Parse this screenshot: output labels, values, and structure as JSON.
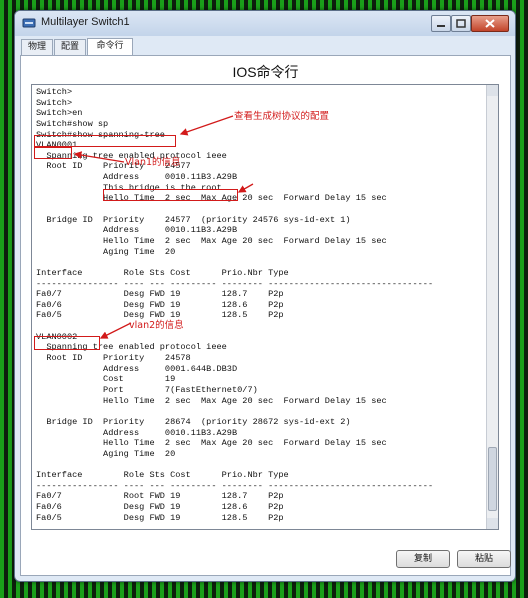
{
  "window": {
    "title": "Multilayer Switch1"
  },
  "tabs": [
    {
      "label": "物理",
      "active": false
    },
    {
      "label": "配置",
      "active": false
    },
    {
      "label": "命令行",
      "active": true
    }
  ],
  "panel": {
    "title": "IOS命令行"
  },
  "console_lines": [
    "Switch>",
    "Switch>",
    "Switch>en",
    "Switch#show sp",
    "Switch#show spanning-tree",
    "VLAN0001",
    "  Spanning tree enabled protocol ieee",
    "  Root ID    Priority    24577",
    "             Address     0010.11B3.A29B",
    "             This bridge is the root",
    "             Hello Time  2 sec  Max Age 20 sec  Forward Delay 15 sec",
    "",
    "  Bridge ID  Priority    24577  (priority 24576 sys-id-ext 1)",
    "             Address     0010.11B3.A29B",
    "             Hello Time  2 sec  Max Age 20 sec  Forward Delay 15 sec",
    "             Aging Time  20",
    "",
    "Interface        Role Sts Cost      Prio.Nbr Type",
    "---------------- ---- --- --------- -------- --------------------------------",
    "Fa0/7            Desg FWD 19        128.7    P2p",
    "Fa0/6            Desg FWD 19        128.6    P2p",
    "Fa0/5            Desg FWD 19        128.5    P2p",
    "",
    "VLAN0002",
    "  Spanning tree enabled protocol ieee",
    "  Root ID    Priority    24578",
    "             Address     0001.644B.DB3D",
    "             Cost        19",
    "             Port        7(FastEthernet0/7)",
    "             Hello Time  2 sec  Max Age 20 sec  Forward Delay 15 sec",
    "",
    "  Bridge ID  Priority    28674  (priority 28672 sys-id-ext 2)",
    "             Address     0010.11B3.A29B",
    "             Hello Time  2 sec  Max Age 20 sec  Forward Delay 15 sec",
    "             Aging Time  20",
    "",
    "Interface        Role Sts Cost      Prio.Nbr Type",
    "---------------- ---- --- --------- -------- --------------------------------",
    "Fa0/7            Root FWD 19        128.7    P2p",
    "Fa0/6            Desg FWD 19        128.6    P2p",
    "Fa0/5            Desg FWD 19        128.5    P2p"
  ],
  "annotations": {
    "config": "查看生成树协议的配置",
    "vlan1": "Vlan1的信息",
    "vlan2": "vlan2的信息"
  },
  "buttons": {
    "copy": "复制",
    "paste": "粘贴"
  },
  "colors": {
    "annotation": "#d21a1a",
    "background_stripe": "#1aa01a"
  },
  "icons": {
    "app": "switch-icon",
    "minimize": "minimize-icon",
    "maximize": "maximize-icon",
    "close": "close-icon"
  }
}
